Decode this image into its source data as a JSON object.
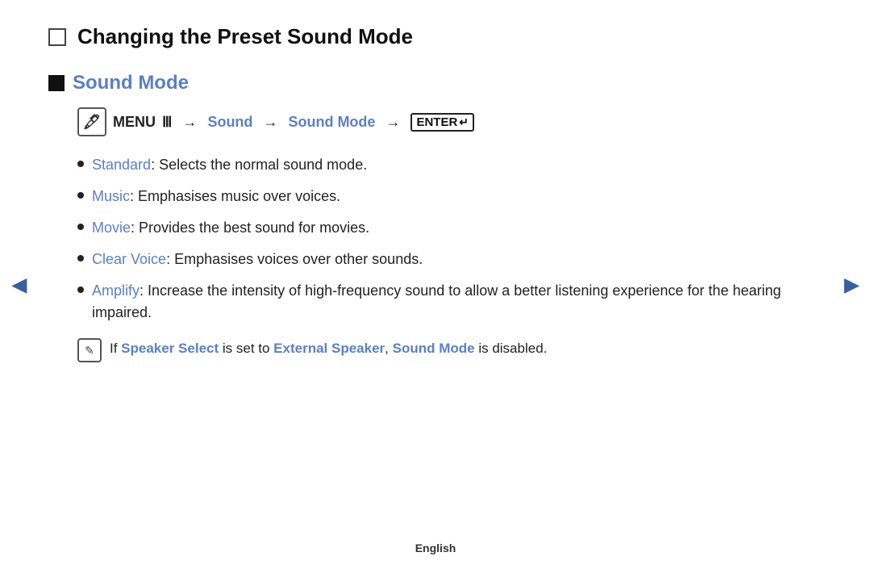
{
  "page": {
    "main_title": "Changing the Preset Sound Mode",
    "section_title": "Sound Mode",
    "menu_label": "MENU",
    "menu_arrow": "→",
    "menu_sound": "Sound",
    "menu_sound_mode": "Sound Mode",
    "enter_label": "ENTER",
    "bullet_items": [
      {
        "term": "Standard",
        "description": ": Selects the normal sound mode."
      },
      {
        "term": "Music",
        "description": ": Emphasises music over voices."
      },
      {
        "term": "Movie",
        "description": ": Provides the best sound for movies."
      },
      {
        "term": "Clear Voice",
        "description": ": Emphasises voices over other sounds."
      },
      {
        "term": "Amplify",
        "description": ": Increase the intensity of high-frequency sound to allow a better listening experience for the hearing impaired."
      }
    ],
    "note_prefix": "If ",
    "note_speaker_select": "Speaker Select",
    "note_middle": " is set to ",
    "note_external_speaker": "External Speaker",
    "note_comma": ",",
    "note_sound_mode": "Sound Mode",
    "note_suffix": " is disabled.",
    "nav_left": "◄",
    "nav_right": "►",
    "footer": "English"
  }
}
